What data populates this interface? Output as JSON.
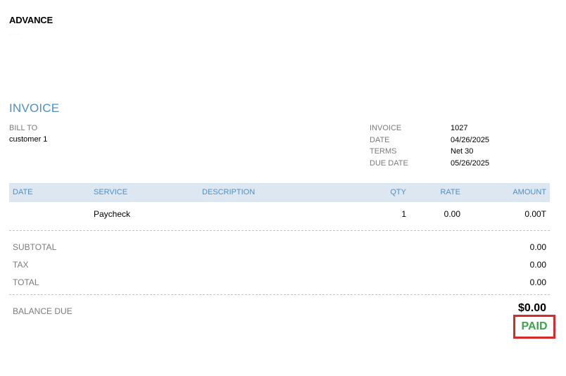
{
  "company": {
    "name": "ADVANCE",
    "subline": "· · ·  ·   ·"
  },
  "invoice": {
    "title": "INVOICE",
    "bill_to_label": "BILL TO",
    "bill_to_value": "customer 1",
    "meta": [
      {
        "label": "INVOICE",
        "value": "1027"
      },
      {
        "label": "DATE",
        "value": "04/26/2025"
      },
      {
        "label": "TERMS",
        "value": "Net 30"
      },
      {
        "label": "DUE DATE",
        "value": "05/26/2025"
      }
    ]
  },
  "table": {
    "headers": {
      "date": "DATE",
      "service": "SERVICE",
      "description": "DESCRIPTION",
      "qty": "QTY",
      "rate": "RATE",
      "amount": "AMOUNT"
    },
    "rows": [
      {
        "date": "",
        "service": "Paycheck",
        "description": "",
        "qty": "1",
        "rate": "0.00",
        "amount": "0.00T"
      }
    ]
  },
  "totals": {
    "subtotal_label": "SUBTOTAL",
    "subtotal_value": "0.00",
    "tax_label": "TAX",
    "tax_value": "0.00",
    "total_label": "TOTAL",
    "total_value": "0.00",
    "balance_label": "BALANCE DUE",
    "balance_value": "$0.00"
  },
  "stamp": {
    "text": "PAID",
    "border_color": "#d82a2a",
    "text_color": "#3aa64a"
  },
  "colors": {
    "accent": "#4f8fc4",
    "header_bg": "#dce7f1",
    "label_gray": "#7b7b7b"
  }
}
